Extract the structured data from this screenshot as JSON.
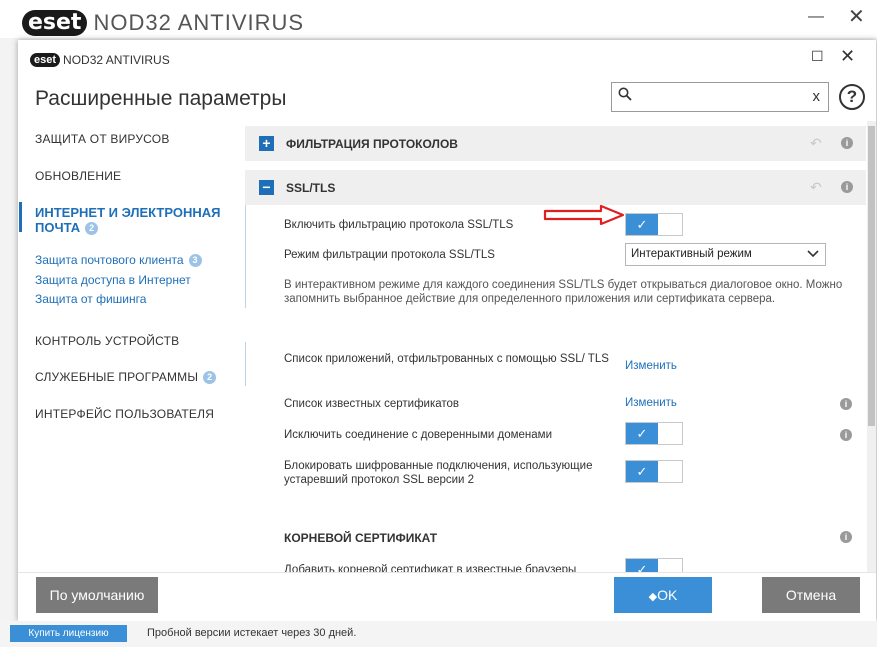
{
  "background_window": {
    "logo": "eset",
    "title": "NOD32 ANTIVIRUS",
    "minimize": "—",
    "close": "✕"
  },
  "dialog": {
    "logo": "eset",
    "title": "NOD32 ANTIVIRUS",
    "maximize": "☐",
    "close": "✕",
    "page_title": "Расширенные параметры",
    "search": {
      "value": "",
      "placeholder": "",
      "clear": "x"
    },
    "help": "?"
  },
  "sidebar": {
    "items": [
      {
        "label": "ЗАЩИТА ОТ ВИРУСОВ"
      },
      {
        "label": "ОБНОВЛЕНИЕ"
      },
      {
        "label": "ИНТЕРНЕТ И ЭЛЕКТРОННАЯ ПОЧТА",
        "badge": "2"
      },
      {
        "label": "КОНТРОЛЬ УСТРОЙСТВ"
      },
      {
        "label": "СЛУЖЕБНЫЕ ПРОГРАММЫ",
        "badge": "2"
      },
      {
        "label": "ИНТЕРФЕЙС ПОЛЬЗОВАТЕЛЯ"
      }
    ],
    "active_line1": "ИНТЕРНЕТ И ЭЛЕКТРОННАЯ",
    "active_line2": "ПОЧТА",
    "sublinks": [
      {
        "label": "Защита почтового клиента",
        "badge": "3"
      },
      {
        "label": "Защита доступа в Интернет"
      },
      {
        "label": "Защита от фишинга"
      }
    ]
  },
  "content": {
    "section_protocol": {
      "toggle": "+",
      "title": "ФИЛЬТРАЦИЯ ПРОТОКОЛОВ"
    },
    "section_ssl": {
      "toggle": "−",
      "title": "SSL/TLS"
    },
    "revert_symbol": "↶",
    "info_symbol": "i",
    "enable_ssl_label": "Включить фильтрацию протокола SSL/TLS",
    "mode_label": "Режим фильтрации протокола SSL/TLS",
    "mode_value": "Интерактивный режим",
    "mode_description": "В интерактивном режиме для каждого соединения SSL/TLS будет открываться диалоговое окно. Можно запомнить выбранное действие для определенного приложения или сертификата сервера.",
    "apps_list_label": "Список приложений, отфильтрованных с помощью SSL/ TLS",
    "apps_list_link": "Изменить",
    "certs_list_label": "Список известных сертификатов",
    "certs_list_link": "Изменить",
    "exclude_trusted_label": "Исключить соединение с доверенными доменами",
    "block_obsolete_label": "Блокировать шифрованные подключения, использующие устаревший протокол SSL версии 2",
    "root_cert_title": "КОРНЕВОЙ СЕРТИФИКАТ",
    "add_root_label": "Добавить корневой сертификат в известные браузеры",
    "check_mark": "✓"
  },
  "footer": {
    "default_label": "По умолчанию",
    "ok_label": "OK",
    "ok_icon": "◆",
    "cancel_label": "Отмена"
  },
  "status_bar": {
    "buy_label": "Купить лицензию",
    "trial_text": "Пробной версии истекает через 30 дней."
  },
  "colors": {
    "accent": "#3a8fd6",
    "link": "#1e6fb8",
    "arrow": "#e02020",
    "button_grey": "#7a7a7a"
  }
}
